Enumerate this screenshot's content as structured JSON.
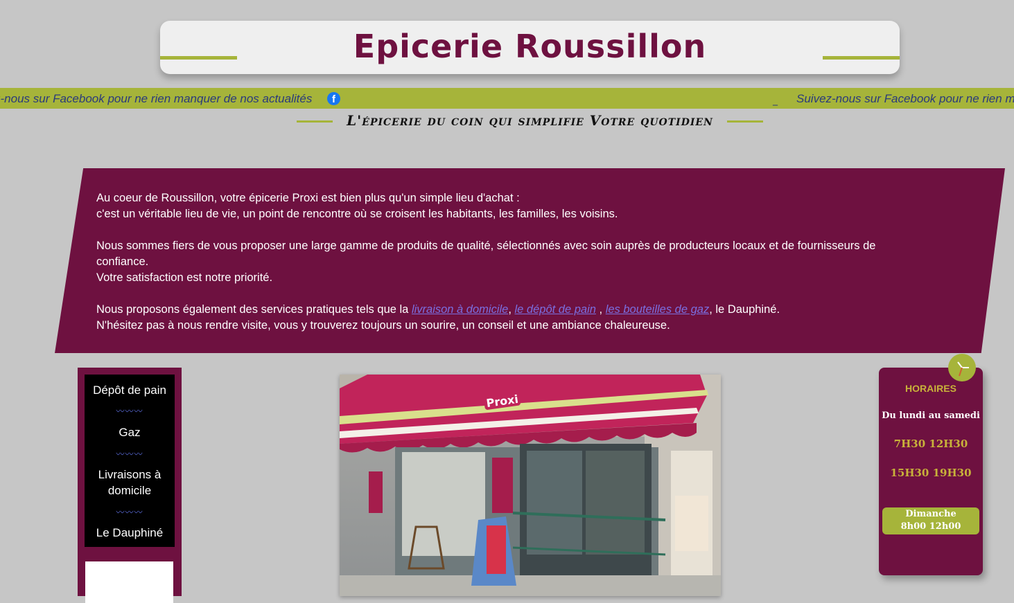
{
  "header": {
    "title": "Epicerie Roussillon"
  },
  "banner": {
    "message_1": "z-nous sur Facebook pour ne rien manquer de nos actualités",
    "message_2": "Suivez-nous sur Facebook pour ne rien ma",
    "icon": "facebook-icon",
    "separator": "_"
  },
  "tagline": "L'épicerie du coin qui simplifie Votre quotidien",
  "intro": {
    "line1": "Au coeur de Roussillon, votre épicerie Proxi est bien plus qu'un simple lieu d'achat :",
    "line2": "c'est un véritable lieu de vie, un point de rencontre où se croisent les habitants, les familles, les voisins.",
    "line3": "Nous sommes fiers de vous proposer une large gamme de produits de qualité, sélectionnés avec soin auprès de producteurs locaux et de fournisseurs de confiance.",
    "line4": "Votre satisfaction est notre priorité.",
    "services_prefix": "Nous proposons également des services pratiques tels que la ",
    "link_livraison": "livraison à domicile",
    "comma1": ", ",
    "link_depot": "le dépôt de pain",
    "comma2": " , ",
    "link_gaz": "les bouteilles de gaz",
    "services_suffix": ", le Dauphiné.",
    "line6": "N'hésitez pas à nous rendre visite, vous y trouverez toujours un sourire, un conseil et une ambiance chaleureuse."
  },
  "sidebar": {
    "items": [
      {
        "label": "Dépôt de pain"
      },
      {
        "label": "Gaz"
      },
      {
        "label": "Livraisons à domicile"
      },
      {
        "label": "Le Dauphiné"
      }
    ],
    "divider": "〰〰〰"
  },
  "photo": {
    "store_sign": "Proxi"
  },
  "hours": {
    "title": "HORAIRES",
    "days": "Du lundi au samedi",
    "morning": "7H30 12H30",
    "afternoon": "15H30 19H30",
    "sunday_label": "Dimanche",
    "sunday_hours": "8h00 12h00"
  },
  "colors": {
    "brand": "#6e1140",
    "accent": "#a6b43a",
    "background": "#c6c6c6"
  }
}
